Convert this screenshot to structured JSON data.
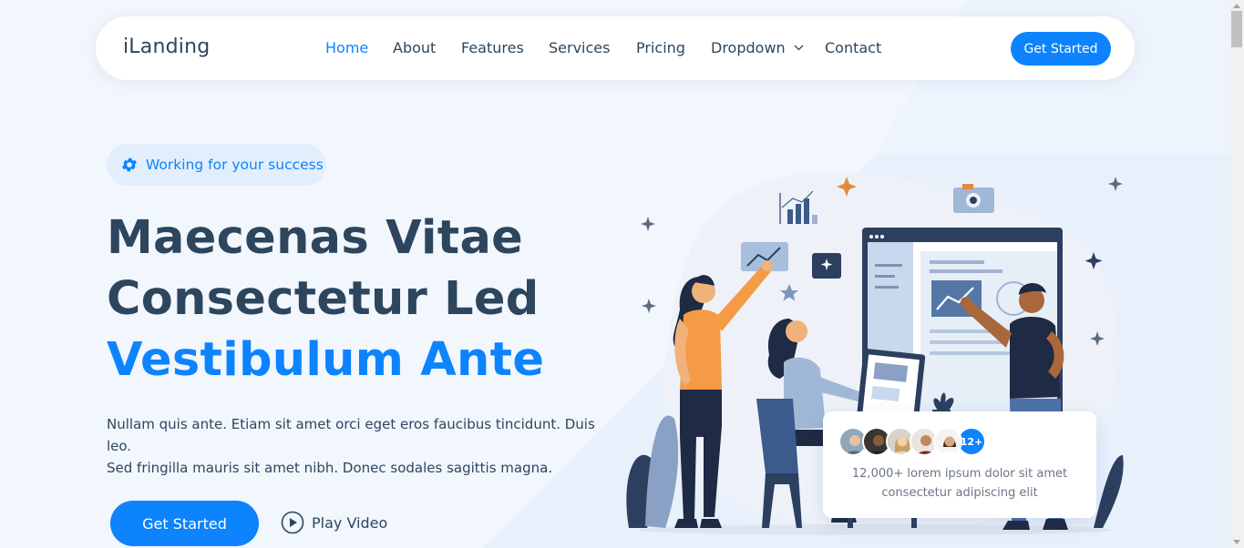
{
  "header": {
    "logo": "iLanding",
    "nav": [
      {
        "label": "Home",
        "active": true
      },
      {
        "label": "About"
      },
      {
        "label": "Features"
      },
      {
        "label": "Services"
      },
      {
        "label": "Pricing"
      },
      {
        "label": "Dropdown",
        "has_submenu": true
      },
      {
        "label": "Contact"
      }
    ],
    "cta_label": "Get Started"
  },
  "hero": {
    "badge_icon": "gear-icon",
    "badge_text": "Working for your success",
    "title_line1": "Maecenas Vitae",
    "title_line2": "Consectetur Led",
    "title_line3": "Vestibulum Ante",
    "description_line1": "Nullam quis ante. Etiam sit amet orci eget eros faucibus tincidunt. Duis leo.",
    "description_line2": "Sed fringilla mauris sit amet nibh. Donec sodales sagittis magna.",
    "cta_label": "Get Started",
    "play_label": "Play Video",
    "play_icon": "play-circle-icon"
  },
  "customers_card": {
    "count_badge": "12+",
    "text_line1": "12,000+ lorem ipsum dolor sit amet",
    "text_line2": "consectetur adipiscing elit"
  },
  "colors": {
    "accent": "#0d83fd",
    "heading": "#2d465e",
    "background": "#f2f6fd"
  }
}
